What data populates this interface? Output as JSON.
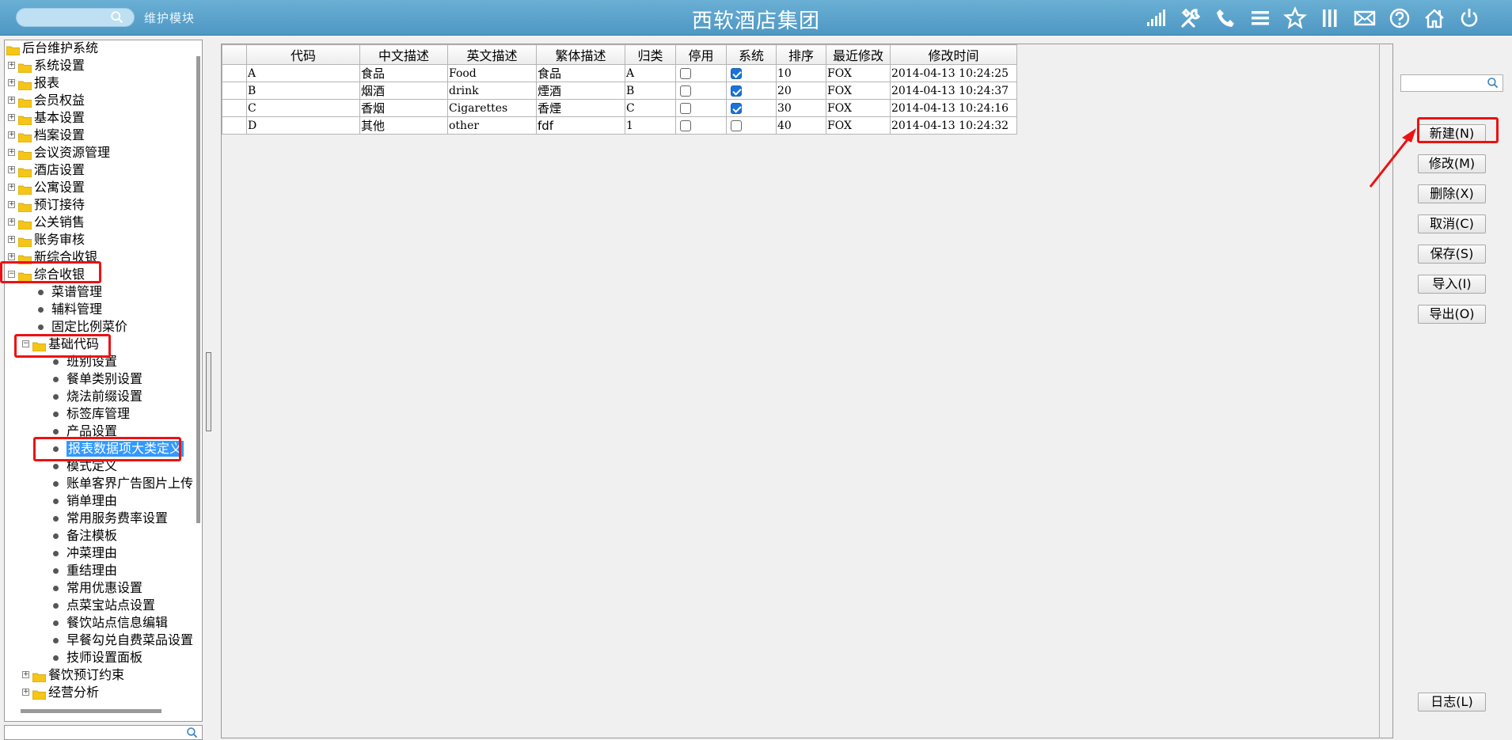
{
  "header": {
    "title": "西软酒店集团",
    "module_label": "维护模块",
    "search_placeholder": "",
    "icons": [
      "signal-icon",
      "tools-icon",
      "phone-icon",
      "menu-icon",
      "star-icon",
      "columns-icon",
      "mail-icon",
      "help-icon",
      "home-icon",
      "power-icon"
    ]
  },
  "tree": {
    "root": "后台维护系统",
    "nodes": [
      {
        "label": "系统设置",
        "type": "folder",
        "expanded": false
      },
      {
        "label": "报表",
        "type": "folder",
        "expanded": false
      },
      {
        "label": "会员权益",
        "type": "folder",
        "expanded": false
      },
      {
        "label": "基本设置",
        "type": "folder",
        "expanded": false
      },
      {
        "label": "档案设置",
        "type": "folder",
        "expanded": false
      },
      {
        "label": "会议资源管理",
        "type": "folder",
        "expanded": false
      },
      {
        "label": "酒店设置",
        "type": "folder",
        "expanded": false
      },
      {
        "label": "公寓设置",
        "type": "folder",
        "expanded": false
      },
      {
        "label": "预订接待",
        "type": "folder",
        "expanded": false
      },
      {
        "label": "公关销售",
        "type": "folder",
        "expanded": false
      },
      {
        "label": "账务审核",
        "type": "folder",
        "expanded": false
      },
      {
        "label": "新综合收银",
        "type": "folder",
        "expanded": false
      },
      {
        "label": "综合收银",
        "type": "folder",
        "expanded": true
      },
      {
        "label": "菜谱管理",
        "type": "leaf",
        "level": 1
      },
      {
        "label": "辅料管理",
        "type": "leaf",
        "level": 1
      },
      {
        "label": "固定比例菜价",
        "type": "leaf",
        "level": 1
      },
      {
        "label": "基础代码",
        "type": "folder",
        "expanded": true,
        "level": 1
      },
      {
        "label": "班别设置",
        "type": "leaf",
        "level": 2
      },
      {
        "label": "餐单类别设置",
        "type": "leaf",
        "level": 2
      },
      {
        "label": "烧法前缀设置",
        "type": "leaf",
        "level": 2
      },
      {
        "label": "标签库管理",
        "type": "leaf",
        "level": 2
      },
      {
        "label": "产品设置",
        "type": "leaf",
        "level": 2
      },
      {
        "label": "报表数据项大类定义",
        "type": "leaf",
        "level": 2,
        "selected": true
      },
      {
        "label": "模式定义",
        "type": "leaf",
        "level": 2
      },
      {
        "label": "账单客界广告图片上传",
        "type": "leaf",
        "level": 2
      },
      {
        "label": "销单理由",
        "type": "leaf",
        "level": 2
      },
      {
        "label": "常用服务费率设置",
        "type": "leaf",
        "level": 2
      },
      {
        "label": "备注模板",
        "type": "leaf",
        "level": 2
      },
      {
        "label": "冲菜理由",
        "type": "leaf",
        "level": 2
      },
      {
        "label": "重结理由",
        "type": "leaf",
        "level": 2
      },
      {
        "label": "常用优惠设置",
        "type": "leaf",
        "level": 2
      },
      {
        "label": "点菜宝站点设置",
        "type": "leaf",
        "level": 2
      },
      {
        "label": "餐饮站点信息编辑",
        "type": "leaf",
        "level": 2
      },
      {
        "label": "早餐勾兑自费菜品设置",
        "type": "leaf",
        "level": 2
      },
      {
        "label": "技师设置面板",
        "type": "leaf",
        "level": 2
      },
      {
        "label": "餐饮预订约束",
        "type": "folder",
        "expanded": false,
        "level": 1
      },
      {
        "label": "经营分析",
        "type": "folder",
        "expanded": false,
        "level": 1
      }
    ]
  },
  "grid": {
    "columns": [
      "代码",
      "中文描述",
      "英文描述",
      "繁体描述",
      "归类",
      "停用",
      "系统",
      "排序",
      "最近修改",
      "修改时间"
    ],
    "rows": [
      {
        "code": "A",
        "zh": "食品",
        "en": "Food",
        "tw": "食品",
        "cat": "A",
        "disabled": false,
        "system": true,
        "order": "10",
        "modifier": "FOX",
        "time": "2014-04-13 10:24:25"
      },
      {
        "code": "B",
        "zh": "烟酒",
        "en": "drink",
        "tw": "煙酒",
        "cat": "B",
        "disabled": false,
        "system": true,
        "order": "20",
        "modifier": "FOX",
        "time": "2014-04-13 10:24:37"
      },
      {
        "code": "C",
        "zh": "香烟",
        "en": "Cigarettes",
        "tw": "香煙",
        "cat": "C",
        "disabled": false,
        "system": true,
        "order": "30",
        "modifier": "FOX",
        "time": "2014-04-13 10:24:16"
      },
      {
        "code": "D",
        "zh": "其他",
        "en": "other",
        "tw": "fdf",
        "cat": "1",
        "disabled": false,
        "system": false,
        "order": "40",
        "modifier": "FOX",
        "time": "2014-04-13 10:24:32"
      }
    ]
  },
  "actions": {
    "new": "新建(N)",
    "edit": "修改(M)",
    "delete": "删除(X)",
    "cancel": "取消(C)",
    "save": "保存(S)",
    "import": "导入(I)",
    "export": "导出(O)",
    "log": "日志(L)"
  },
  "colors": {
    "header": "#5ba4cc",
    "annotation": "#ee1111",
    "selection": "#3399ff",
    "checkbox_on": "#1a73d9"
  }
}
